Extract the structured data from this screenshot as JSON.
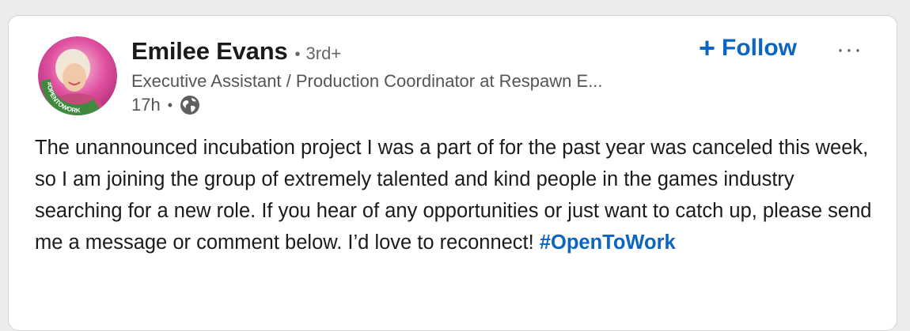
{
  "post": {
    "author": {
      "name": "Emilee Evans",
      "degree": "3rd+",
      "headline": "Executive Assistant / Production Coordinator at Respawn E...",
      "avatar_badge_text": "#OPENTOWORK",
      "avatar_badge_color": "#3f8a3f"
    },
    "meta": {
      "time": "17h",
      "visibility_icon": "globe-icon"
    },
    "follow_label": "Follow",
    "follow_icon": "plus-icon",
    "more_icon": "more-options-icon",
    "text": "The unannounced incubation project I was a part of for the past year was canceled this week, so I am joining the group of extremely talented and kind people in the games industry searching for a new role. If you hear of any opportunities or just want to catch up, please send me a message or comment below. I’d love to reconnect! ",
    "hashtag": "#OpenToWork",
    "accent_color": "#0a66c2"
  },
  "separators": {
    "dot": "•"
  }
}
